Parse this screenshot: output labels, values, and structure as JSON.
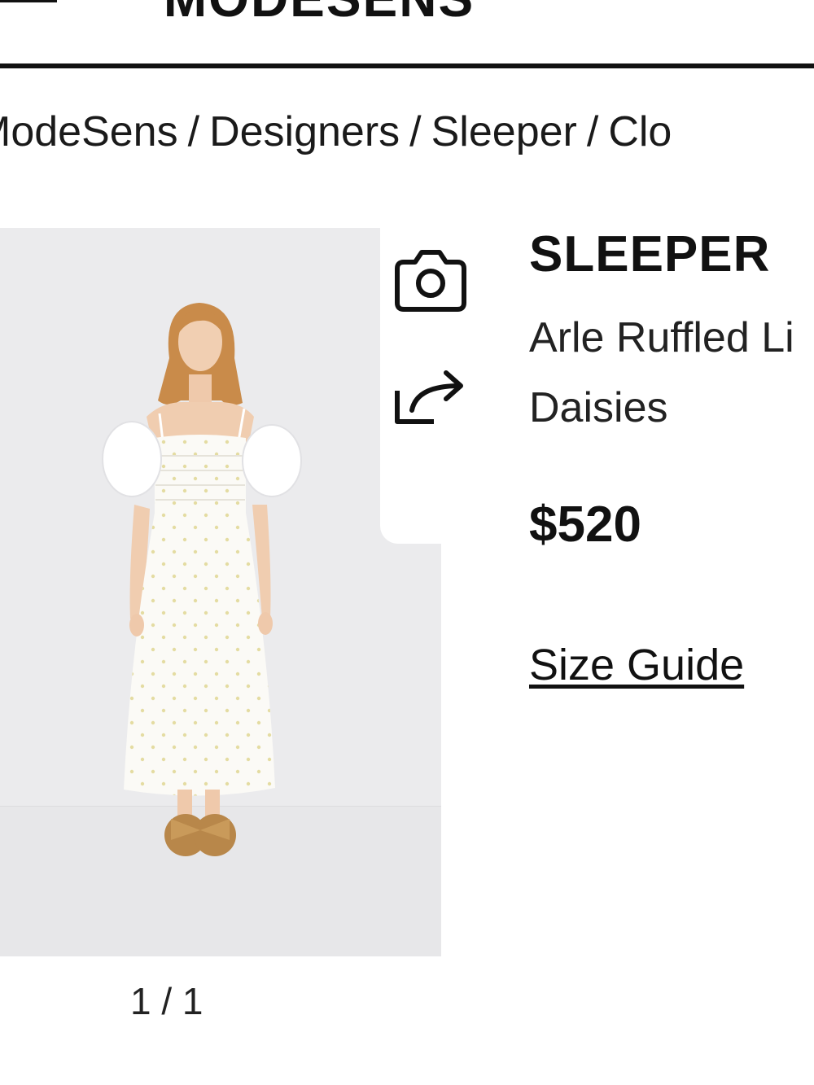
{
  "header": {
    "logo_text": "MODESENS"
  },
  "breadcrumb": [
    "ModeSens",
    "Designers",
    "Sleeper",
    "Clo"
  ],
  "gallery": {
    "pager": "1 / 1",
    "tools": [
      "camera-icon",
      "share-icon"
    ]
  },
  "product": {
    "brand": "SLEEPER",
    "name_line1": "Arle Ruffled Li",
    "name_line2": "Daisies",
    "price": "$520",
    "size_guide": "Size Guide"
  },
  "colors": {
    "text": "#111111",
    "image_bg": "#ebebed",
    "dress": "#fbfaf6",
    "hair": "#c98b4a",
    "sandal": "#b8874a"
  }
}
